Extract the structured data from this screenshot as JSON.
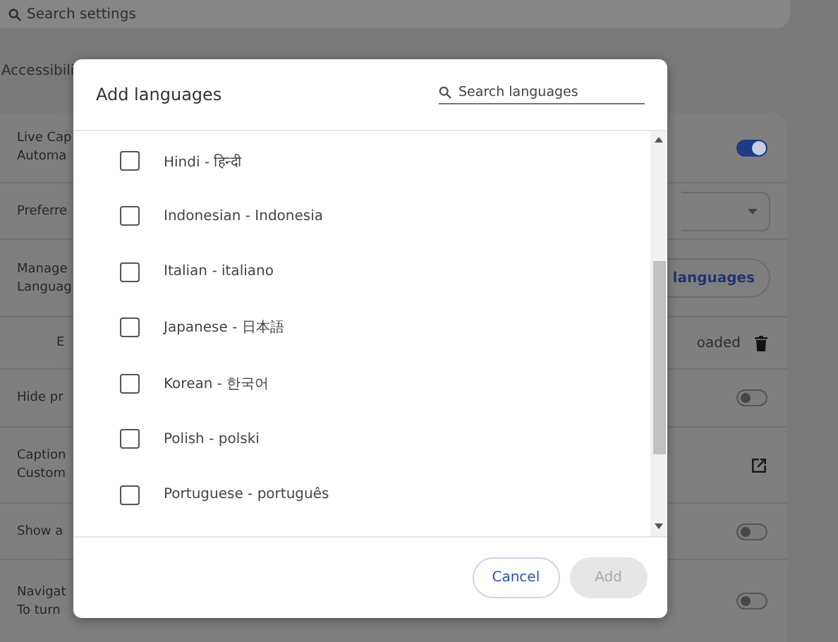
{
  "search": {
    "placeholder": "Search settings"
  },
  "section_title": "Accessibili",
  "settings_rows": [
    {
      "kind": "toggle",
      "lines": [
        "Live Cap",
        "Automa"
      ],
      "on": true
    },
    {
      "kind": "dropdown",
      "lines": [
        "Preferre"
      ]
    },
    {
      "kind": "button",
      "lines": [
        "Manage",
        "Languag"
      ],
      "button": "languages"
    },
    {
      "kind": "download",
      "lines": [
        "E"
      ],
      "status": "oaded"
    },
    {
      "kind": "toggle",
      "lines": [
        "Hide pr"
      ],
      "on": false
    },
    {
      "kind": "link",
      "lines": [
        "Caption",
        "Custom"
      ]
    },
    {
      "kind": "toggle",
      "lines": [
        "Show a"
      ],
      "on": false
    },
    {
      "kind": "toggle",
      "lines": [
        "Navigat",
        "To turn"
      ],
      "on": false
    }
  ],
  "dialog": {
    "title": "Add languages",
    "search": {
      "placeholder": "Search languages"
    },
    "languages": [
      {
        "label": "Hindi - हिन्दी",
        "checked": false
      },
      {
        "label": "Indonesian - Indonesia",
        "checked": false
      },
      {
        "label": "Italian - italiano",
        "checked": false
      },
      {
        "label": "Japanese - 日本語",
        "checked": false
      },
      {
        "label": "Korean - 한국어",
        "checked": false
      },
      {
        "label": "Polish - polski",
        "checked": false
      },
      {
        "label": "Portuguese - português",
        "checked": false
      }
    ],
    "buttons": [
      {
        "label": "Cancel",
        "kind": "outline",
        "disabled": false
      },
      {
        "label": "Add",
        "kind": "filled",
        "disabled": true
      }
    ]
  }
}
